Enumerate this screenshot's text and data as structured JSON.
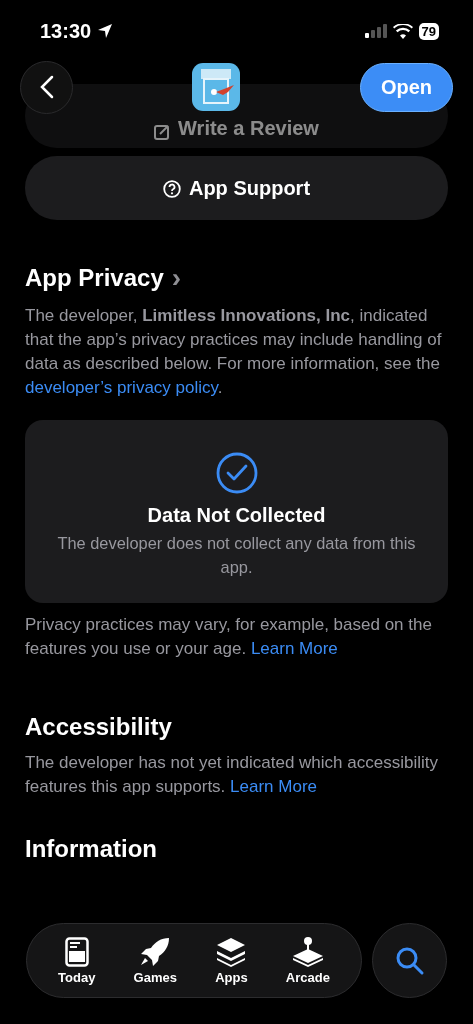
{
  "status_bar": {
    "time": "13:30",
    "battery": "79"
  },
  "nav": {
    "open_button": "Open"
  },
  "review_button": {
    "label": "Write a Review"
  },
  "support_button": {
    "label": "App Support"
  },
  "privacy": {
    "title": "App Privacy",
    "chevron": "›",
    "description": "The developer, **Limitless Innovations, Inc**, indicated that the app’s privacy practices may include handling of data as described below. For more information, see the",
    "link": "developer’s privacy policy",
    "end": ".",
    "card": {
      "title": "Data Not Collected",
      "text": "The developer does not collect any data from this app."
    },
    "note": "Privacy practices may vary, for example, based on the features you use or your age.",
    "note_link": "Learn More"
  },
  "accessibility": {
    "title": "Accessibility",
    "text": "The developer has not yet indicated which accessibility features this app supports.",
    "link": "Learn More"
  },
  "information": {
    "title": "Information"
  },
  "tab_bar": [
    {
      "kind": "today",
      "label": "Today",
      "selected": false
    },
    {
      "kind": "games",
      "label": "Games",
      "selected": false
    },
    {
      "kind": "apps",
      "label": "Apps",
      "selected": false
    },
    {
      "kind": "arcade",
      "label": "Arcade",
      "selected": false
    }
  ],
  "search_tab": {
    "selected": true
  }
}
